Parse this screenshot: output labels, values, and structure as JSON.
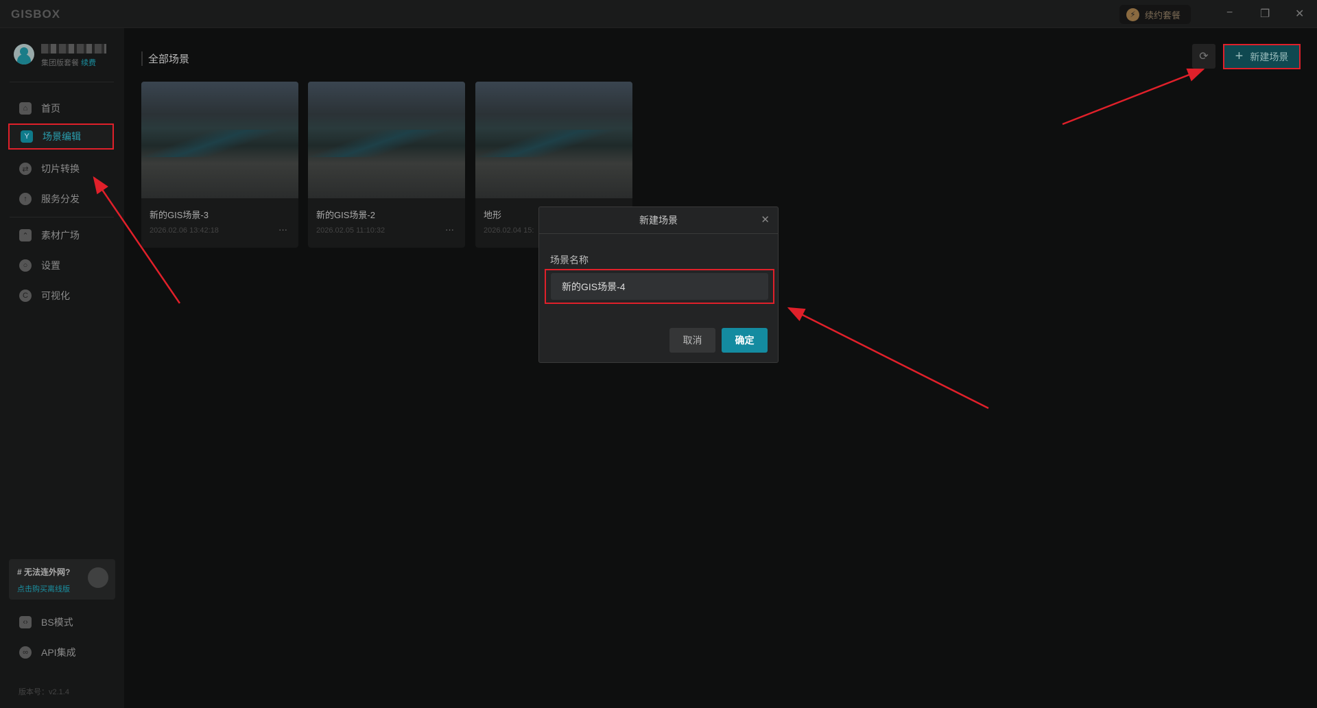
{
  "app": {
    "logo": "GISBOX",
    "renew_label": "续约套餐",
    "minimize": "−",
    "restore": "❐",
    "close": "✕"
  },
  "user": {
    "plan": "集团版套餐",
    "renew_link": "续费"
  },
  "sidebar": {
    "items": [
      {
        "label": "首页",
        "icon": "home-icon"
      },
      {
        "label": "场景编辑",
        "icon": "cube-icon"
      },
      {
        "label": "切片转换",
        "icon": "swap-icon"
      },
      {
        "label": "服务分发",
        "icon": "upload-cloud-icon"
      },
      {
        "label": "素材广场",
        "icon": "image-icon"
      },
      {
        "label": "设置",
        "icon": "gear-icon"
      },
      {
        "label": "可视化",
        "icon": "chart-icon"
      }
    ],
    "promo": {
      "title": "# 无法连外网?",
      "link": "点击购买离线版"
    },
    "bottom": [
      {
        "label": "BS模式",
        "icon": "code-icon"
      },
      {
        "label": "API集成",
        "icon": "link-icon"
      }
    ],
    "version": "版本号：v2.1.4"
  },
  "main": {
    "title": "全部场景",
    "new_button": "新建场景",
    "cards": [
      {
        "name": "新的GIS场景-3",
        "date": "2026.02.06 13:42:18"
      },
      {
        "name": "新的GIS场景-2",
        "date": "2026.02.05 11:10:32"
      },
      {
        "name": "地形",
        "date": "2026.02.04 15:"
      }
    ]
  },
  "dialog": {
    "title": "新建场景",
    "label": "场景名称",
    "value": "新的GIS场景-4",
    "cancel": "取消",
    "ok": "确定"
  },
  "colors": {
    "accent": "#148ba0",
    "highlight": "#e0202a"
  }
}
